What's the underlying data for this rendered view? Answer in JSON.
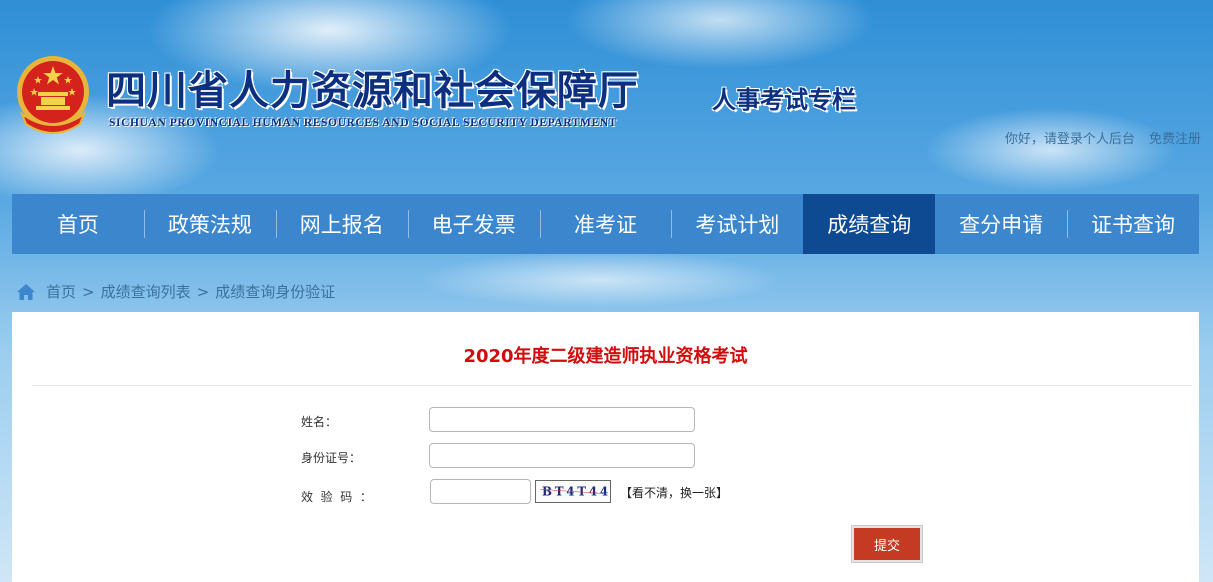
{
  "header": {
    "site_title": "四川省人力资源和社会保障厅",
    "site_subtitle": "SICHUAN PROVINCIAL HUMAN RESOURCES AND SOCIAL SECURITY DEPARTMENT",
    "column_tag": "人事考试专栏",
    "login_link": "你好，请登录个人后台",
    "register_link": "免费注册",
    "emblem_icon": "national-emblem-icon"
  },
  "nav": {
    "items": [
      {
        "label": "首页"
      },
      {
        "label": "政策法规"
      },
      {
        "label": "网上报名"
      },
      {
        "label": "电子发票"
      },
      {
        "label": "准考证"
      },
      {
        "label": "考试计划"
      },
      {
        "label": "成绩查询",
        "active": true
      },
      {
        "label": "查分申请"
      },
      {
        "label": "证书查询"
      }
    ]
  },
  "breadcrumb": {
    "icon": "home-icon",
    "items": [
      "首页",
      "成绩查询列表",
      "成绩查询身份验证"
    ],
    "separator": ">"
  },
  "form": {
    "exam_title": "2020年度二级建造师执业资格考试",
    "name_label": "姓名：",
    "name_value": "",
    "id_label": "身份证号：",
    "id_value": "",
    "captcha_label": "效  验  码  ：",
    "captcha_value": "",
    "captcha_text": "BT4T44",
    "refresh_text": "【看不清，换一张】",
    "submit_label": "提交"
  },
  "colors": {
    "nav_bg": "#3b86cc",
    "nav_active_bg": "#0d4a92",
    "title_red": "#d10c0c",
    "submit_bg": "#c43a22",
    "brand_navy": "#0c2f80"
  }
}
